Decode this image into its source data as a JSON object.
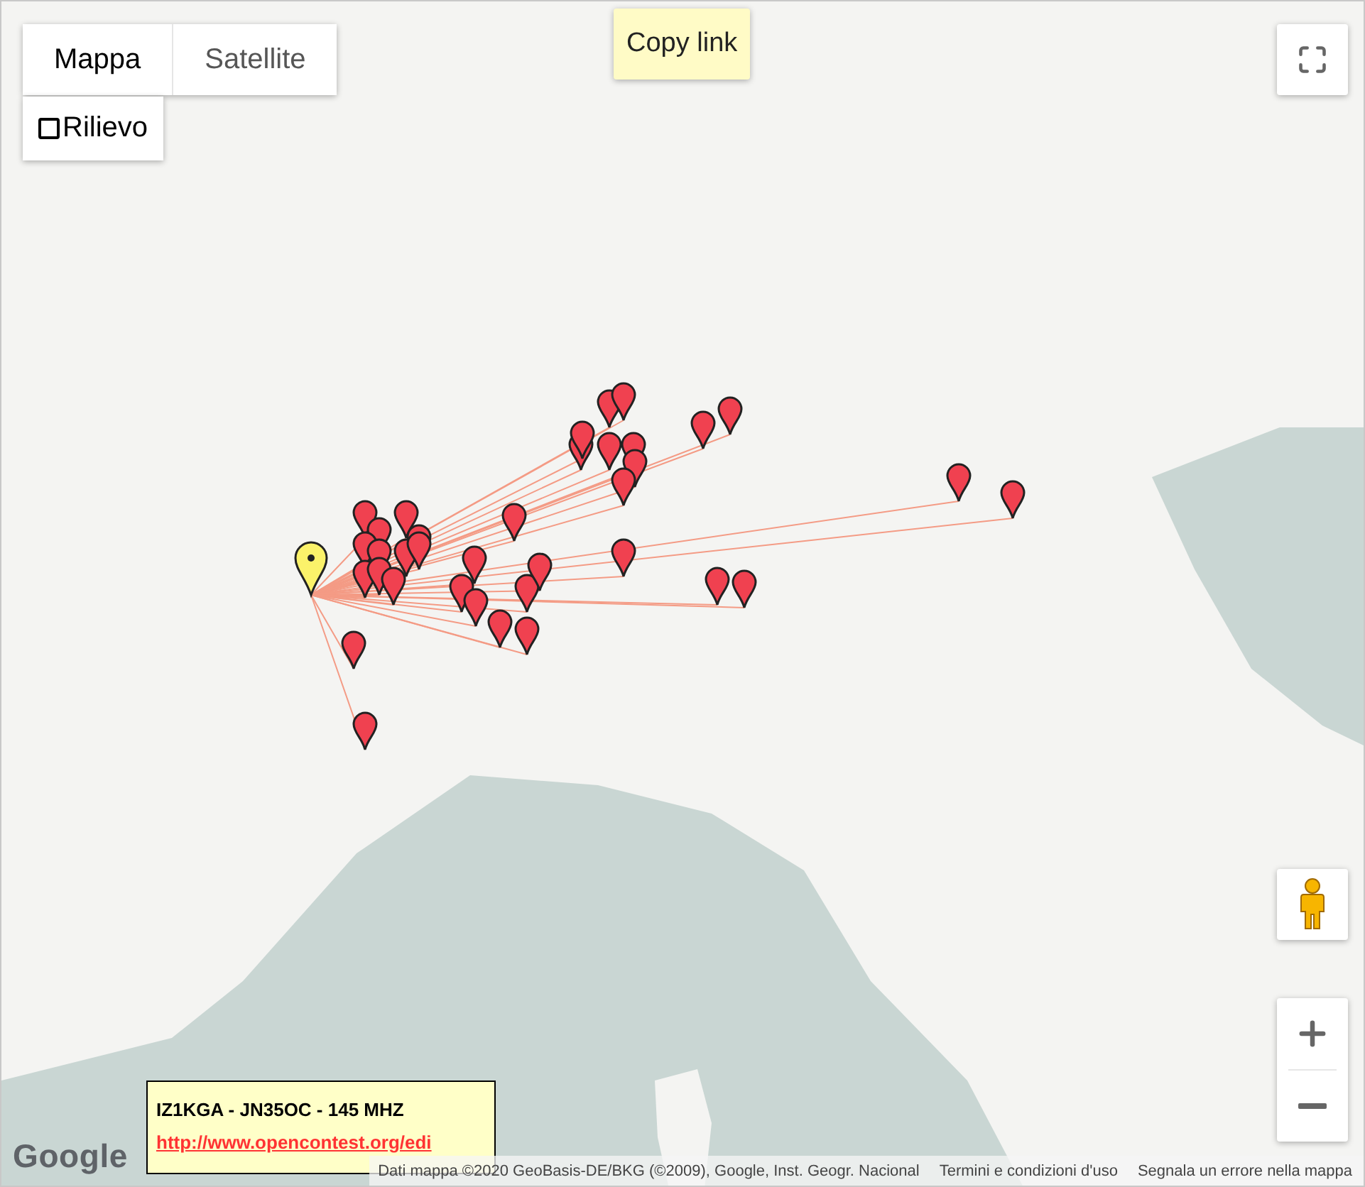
{
  "map_type_control": {
    "options": [
      {
        "label": "Mappa",
        "selected": true
      },
      {
        "label": "Satellite",
        "selected": false
      }
    ],
    "terrain": {
      "label": "Rilievo",
      "checked": false
    }
  },
  "copy_link": {
    "label": "Copy link"
  },
  "info_box": {
    "title": "IZ1KGA - JN35OC - 145 MHZ",
    "link": "http://www.opencontest.org/edi"
  },
  "logo": "Google",
  "attribution": [
    "Dati mappa ©2020 GeoBasis-DE/BKG (©2009), Google, Inst. Geogr. Nacional",
    "Termini e condizioni d'uso",
    "Segnala un errore nella mappa"
  ]
}
